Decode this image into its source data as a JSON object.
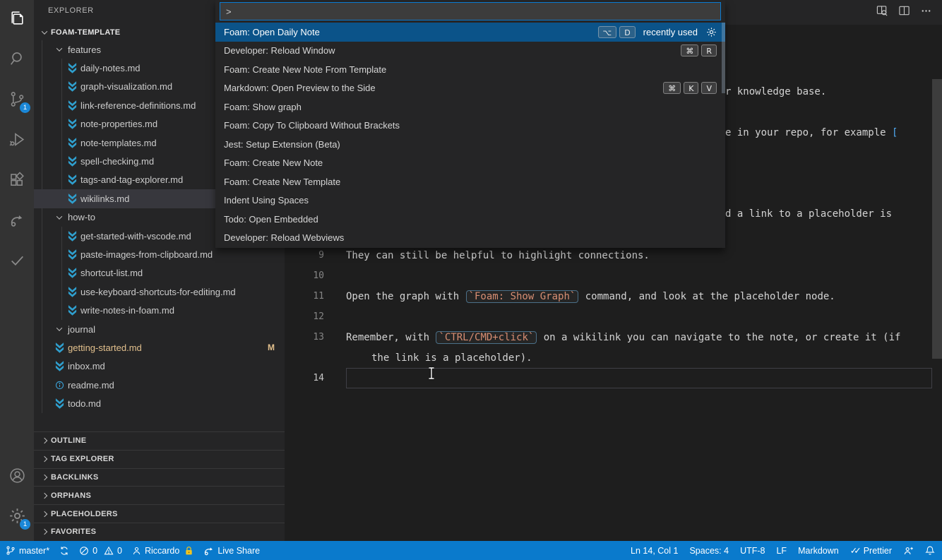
{
  "activity_bar": {
    "scm_badge": "1",
    "settings_badge": "1"
  },
  "explorer": {
    "title": "EXPLORER",
    "root_label": "FOAM-TEMPLATE",
    "tree": [
      {
        "label": "features",
        "cls": "lv1",
        "folder": true
      },
      {
        "label": "daily-notes.md",
        "cls": "lv2",
        "arrow": true
      },
      {
        "label": "graph-visualization.md",
        "cls": "lv2",
        "arrow": true
      },
      {
        "label": "link-reference-definitions.md",
        "cls": "lv2",
        "arrow": true
      },
      {
        "label": "note-properties.md",
        "cls": "lv2",
        "arrow": true
      },
      {
        "label": "note-templates.md",
        "cls": "lv2",
        "arrow": true
      },
      {
        "label": "spell-checking.md",
        "cls": "lv2",
        "arrow": true
      },
      {
        "label": "tags-and-tag-explorer.md",
        "cls": "lv2",
        "arrow": true
      },
      {
        "label": "wikilinks.md",
        "cls": "lv2 selected",
        "arrow": true
      },
      {
        "label": "how-to",
        "cls": "lv1",
        "folder": true
      },
      {
        "label": "get-started-with-vscode.md",
        "cls": "lv2",
        "arrow": true
      },
      {
        "label": "paste-images-from-clipboard.md",
        "cls": "lv2",
        "arrow": true
      },
      {
        "label": "shortcut-list.md",
        "cls": "lv2",
        "arrow": true
      },
      {
        "label": "use-keyboard-shortcuts-for-editing.md",
        "cls": "lv2",
        "arrow": true
      },
      {
        "label": "write-notes-in-foam.md",
        "cls": "lv2",
        "arrow": true
      },
      {
        "label": "journal",
        "cls": "lv1",
        "folder": true
      },
      {
        "label": "getting-started.md",
        "cls": "lv1 modified",
        "arrow": true,
        "badge": "M"
      },
      {
        "label": "inbox.md",
        "cls": "lv1",
        "arrow": true
      },
      {
        "label": "readme.md",
        "cls": "lv1",
        "info": true
      },
      {
        "label": "todo.md",
        "cls": "lv1",
        "arrow": true
      }
    ],
    "panels": [
      {
        "label": "OUTLINE"
      },
      {
        "label": "TAG EXPLORER"
      },
      {
        "label": "BACKLINKS"
      },
      {
        "label": "ORPHANS"
      },
      {
        "label": "PLACEHOLDERS"
      },
      {
        "label": "FAVORITES"
      }
    ]
  },
  "palette": {
    "input_value": ">",
    "items": [
      {
        "label": "Foam: Open Daily Note",
        "cls": "selected",
        "keys": [
          "⌥",
          "D"
        ],
        "note": "recently used",
        "gear": true
      },
      {
        "label": "Developer: Reload Window",
        "keys": [
          "⌘",
          "R"
        ]
      },
      {
        "label": "Foam: Create New Note From Template"
      },
      {
        "label": "Markdown: Open Preview to the Side",
        "keys": [
          "⌘",
          "K",
          "V"
        ]
      },
      {
        "label": "Foam: Show graph"
      },
      {
        "label": "Foam: Copy To Clipboard Without Brackets"
      },
      {
        "label": "Jest: Setup Extension (Beta)"
      },
      {
        "label": "Foam: Create New Note"
      },
      {
        "label": "Foam: Create New Template"
      },
      {
        "label": "Indent Using Spaces"
      },
      {
        "label": "Todo: Open Embedded"
      },
      {
        "label": "Developer: Reload Webviews"
      }
    ]
  },
  "editor": {
    "partial_lines": [
      {
        "text": "r knowledge base."
      },
      {
        "text": "e in your repo, for example ",
        "bracket": "["
      },
      {
        "text": "d a link to a placeholder is"
      }
    ],
    "lines": [
      {
        "num": "9",
        "segments": [
          {
            "t": "They can still be helpful to highlight connections."
          }
        ]
      },
      {
        "num": "10",
        "segments": []
      },
      {
        "num": "11",
        "segments": [
          {
            "t": "Open the graph with "
          },
          {
            "t": "`Foam: Show Graph`",
            "cls": "code"
          },
          {
            "t": " command, and look at the placeholder node."
          }
        ]
      },
      {
        "num": "12",
        "segments": []
      },
      {
        "num": "13",
        "segments": [
          {
            "t": "Remember, with "
          },
          {
            "t": "`CTRL/CMD+click`",
            "cls": "code"
          },
          {
            "t": " on a wikilink you can navigate to the note, or create it (if"
          }
        ]
      },
      {
        "num": "",
        "cls": "wrap",
        "segments": [
          {
            "t": "the link is a placeholder)."
          }
        ]
      },
      {
        "num": "14",
        "cls": "current",
        "segments": []
      }
    ]
  },
  "status_bar": {
    "branch": "master*",
    "errors": "0",
    "warnings": "0",
    "user": "Riccardo",
    "live_share": "Live Share",
    "line_col": "Ln 14, Col 1",
    "spaces": "Spaces: 4",
    "encoding": "UTF-8",
    "eol": "LF",
    "language": "Markdown",
    "formatter": "Prettier"
  }
}
